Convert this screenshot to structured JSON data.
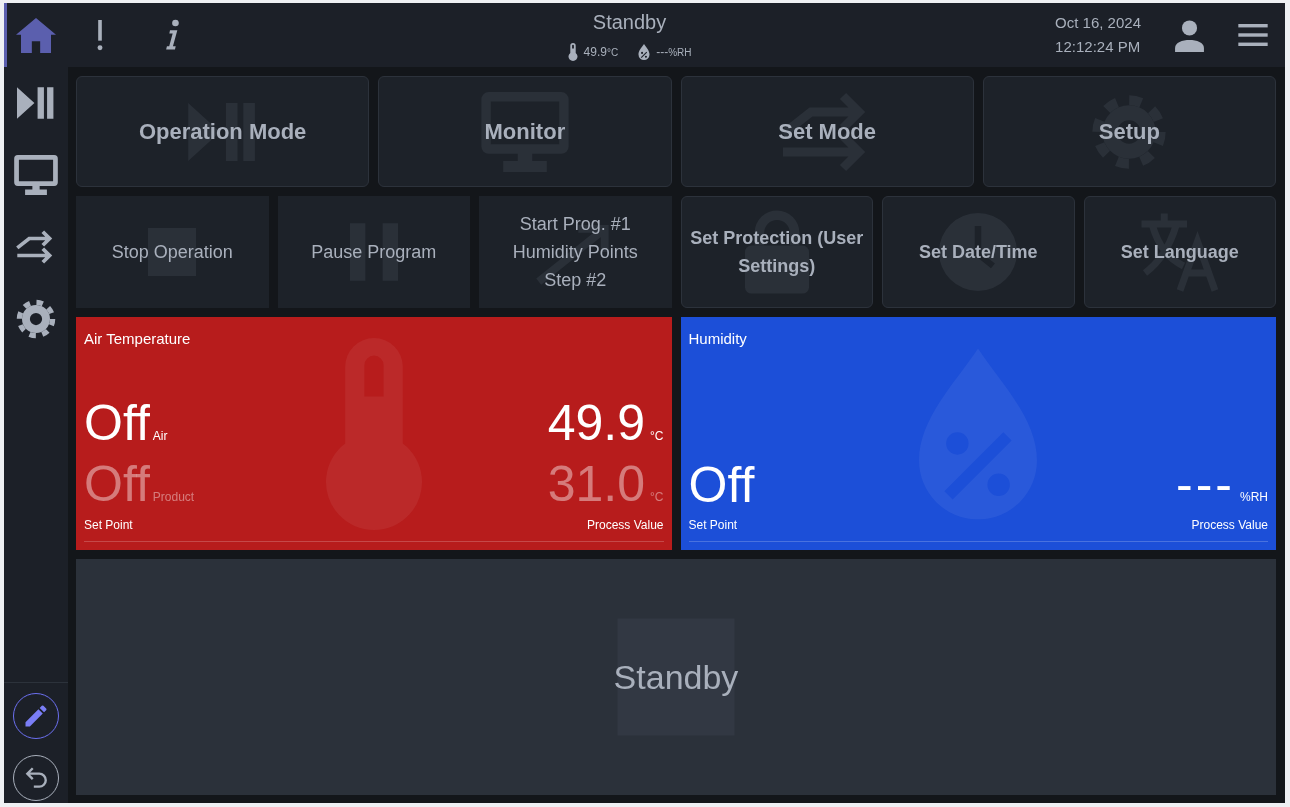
{
  "sidebar": {
    "items": [
      {
        "selected": true
      },
      {
        "selected": false
      },
      {
        "selected": false
      },
      {
        "selected": false
      },
      {
        "selected": false
      }
    ],
    "tools": [
      {
        "on": true
      },
      {
        "on": false
      }
    ]
  },
  "header": {
    "title": "Standby",
    "temperature": "49.9",
    "temperature_unit": "°C",
    "humidity": "---",
    "humidity_unit": "%RH",
    "date": "Oct 16, 2024",
    "time": "12:12:24 PM"
  },
  "menu_buttons": [
    {
      "label": "Operation Mode"
    },
    {
      "label": "Monitor"
    },
    {
      "label": "Set Mode"
    },
    {
      "label": "Setup"
    }
  ],
  "action_buttons": [
    {
      "label": "Stop Operation",
      "kind": "command"
    },
    {
      "label": "Pause Program",
      "kind": "command"
    },
    {
      "label": "Start Prog. #1 Humidity Points Step #2",
      "kind": "command"
    },
    {
      "label": "Set Protection (User Settings)",
      "kind": "setting"
    },
    {
      "label": "Set Date/Time",
      "kind": "setting"
    },
    {
      "label": "Set Language",
      "kind": "setting"
    }
  ],
  "panels": [
    {
      "title": "Air Temperature",
      "color": "#b71c1c",
      "set_points": [
        {
          "value": "Off",
          "label": "Air",
          "disabled": false
        },
        {
          "value": "Off",
          "label": "Product",
          "disabled": true
        }
      ],
      "process_values": [
        {
          "value": "49.9",
          "unit": "°C",
          "disabled": false
        },
        {
          "value": "31.0",
          "unit": "°C",
          "disabled": true
        }
      ],
      "set_point_label": "Set Point",
      "process_value_label": "Process Value"
    },
    {
      "title": "Humidity",
      "color": "#1c4fd8",
      "set_points": [
        {
          "value": "Off",
          "disabled": false
        }
      ],
      "process_values": [
        {
          "value": "---",
          "unit": "%RH",
          "disabled": false
        }
      ],
      "set_point_label": "Set Point",
      "process_value_label": "Process Value"
    }
  ],
  "status_panel": {
    "text": "Standby"
  }
}
